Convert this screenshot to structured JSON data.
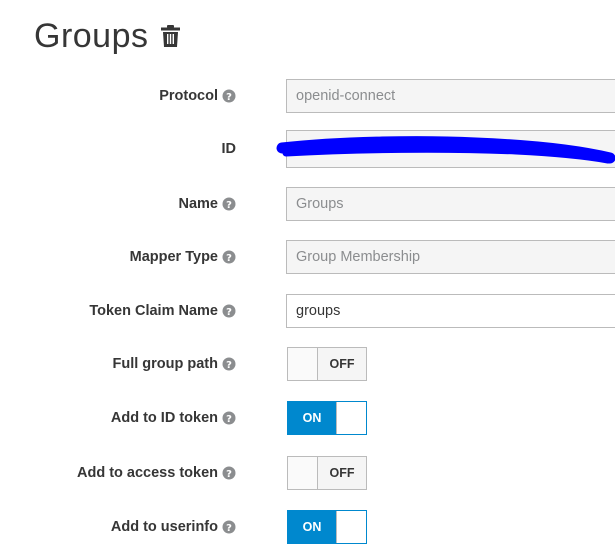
{
  "header": {
    "title": "Groups",
    "delete_icon": "trash-icon"
  },
  "colors": {
    "toggle_on": "#0088ce",
    "label_text": "#363636",
    "readonly_bg": "#f5f5f5",
    "redaction": "#0000ff"
  },
  "fields": {
    "protocol": {
      "label": "Protocol",
      "value": "openid-connect"
    },
    "id": {
      "label": "ID"
    },
    "name": {
      "label": "Name",
      "value": "Groups"
    },
    "mapper_type": {
      "label": "Mapper Type",
      "value": "Group Membership"
    },
    "token_claim_name": {
      "label": "Token Claim Name",
      "value": "groups"
    },
    "full_group_path": {
      "label": "Full group path",
      "state": "OFF"
    },
    "add_to_id_token": {
      "label": "Add to ID token",
      "state": "ON"
    },
    "add_to_access_token": {
      "label": "Add to access token",
      "state": "OFF"
    },
    "add_to_userinfo": {
      "label": "Add to userinfo",
      "state": "ON"
    }
  }
}
